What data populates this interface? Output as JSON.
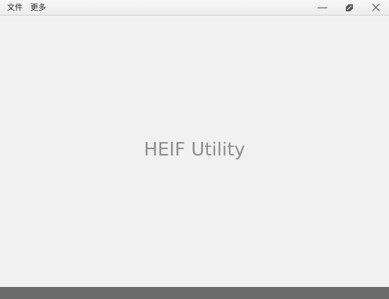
{
  "menu": {
    "file_label": "文件",
    "more_label": "更多"
  },
  "window_controls": {
    "minimize_icon": "minimize-icon",
    "maximize_icon": "restore-icon",
    "close_icon": "close-icon"
  },
  "main": {
    "app_title": "HEIF Utility"
  },
  "colors": {
    "background": "#f1f1f1",
    "title_text": "#8f8f8f",
    "bottom_bar": "#6b6b6b"
  }
}
